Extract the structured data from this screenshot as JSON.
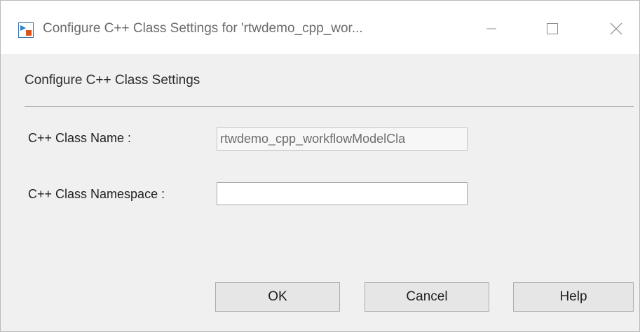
{
  "window": {
    "title": "Configure C++ Class Settings for 'rtwdemo_cpp_wor...",
    "icon": "simulink-model-icon",
    "controls": {
      "minimize": "minimize-icon",
      "maximize": "maximize-icon",
      "close": "close-icon"
    }
  },
  "dialog": {
    "section_title": "Configure C++ Class Settings",
    "fields": {
      "class_name": {
        "label": "C++ Class Name :",
        "value": "rtwdemo_cpp_workflowModelCla"
      },
      "class_namespace": {
        "label": "C++ Class Namespace :",
        "value": ""
      }
    },
    "buttons": {
      "ok": "OK",
      "cancel": "Cancel",
      "help": "Help"
    }
  },
  "colors": {
    "title_text": "#6b6b6b",
    "dialog_bg": "#f0f0f0",
    "button_bg": "#e6e6e6"
  }
}
